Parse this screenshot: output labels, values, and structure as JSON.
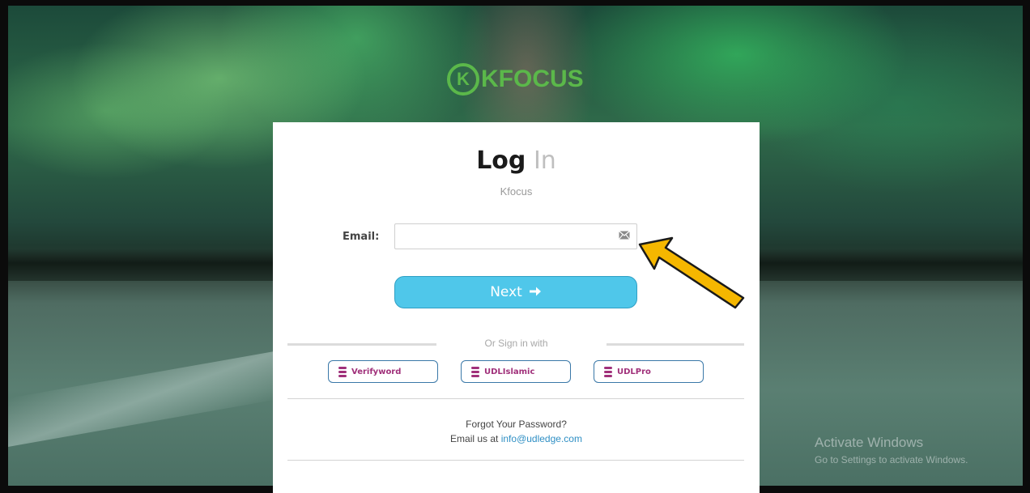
{
  "brand": {
    "logo_mark": "K",
    "logo_text": "KFOCUS"
  },
  "login": {
    "title_bold": "Log",
    "title_light": "In",
    "subtitle": "Kfocus",
    "email_label": "Email:",
    "email_value": "",
    "email_icon": "envelope-icon",
    "next_label": "Next",
    "next_icon": "arrow-right-icon",
    "or_text": "Or Sign in with",
    "sso": [
      {
        "label": "Verifyword",
        "icon": "database-icon"
      },
      {
        "label": "UDLIslamic",
        "icon": "database-icon"
      },
      {
        "label": "UDLPro",
        "icon": "database-icon"
      }
    ],
    "forgot_text": "Forgot Your Password?",
    "contact_prefix": "Email us at",
    "contact_email": "info@udledge.com"
  },
  "os_watermark": {
    "line1": "Activate Windows",
    "line2": "Go to Settings to activate Windows."
  },
  "colors": {
    "brand_green": "#5bb84a",
    "button_blue": "#4fc7ea",
    "sso_magenta": "#a0307a",
    "annotation_arrow": "#f5b700"
  }
}
